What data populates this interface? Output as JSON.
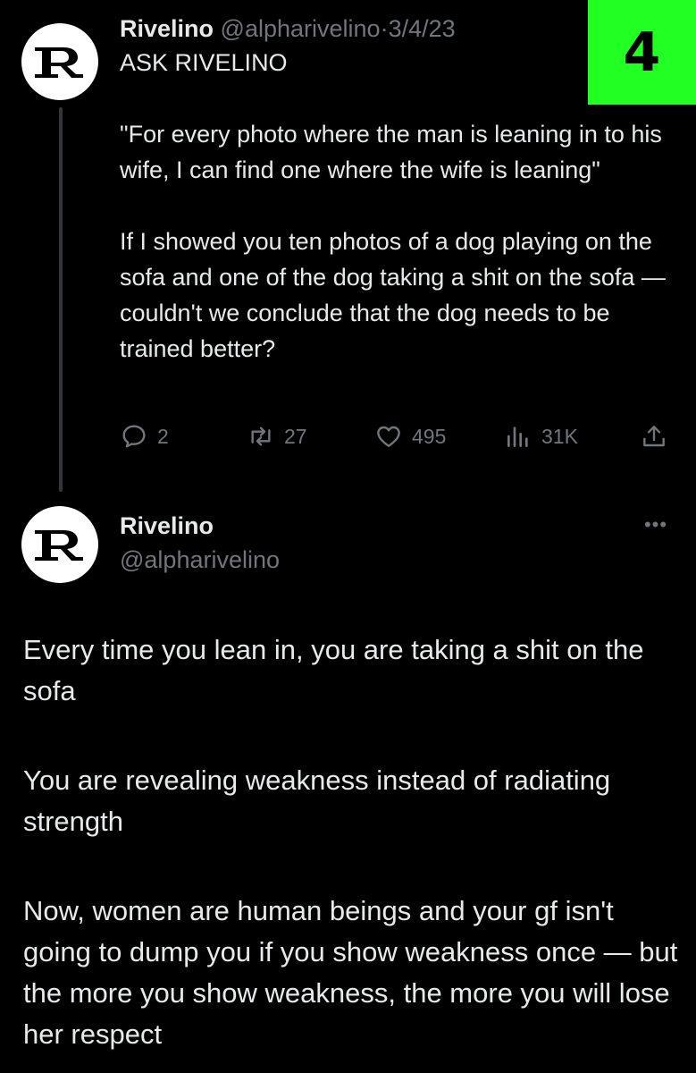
{
  "badge": {
    "number": "4",
    "color": "#22ff22"
  },
  "parent_tweet": {
    "avatar_letter": "R",
    "name": "Rivelino",
    "handle": "@alpharivelino",
    "separator": "·",
    "date": "3/4/23",
    "title": "ASK RIVELINO",
    "paragraphs": [
      "\"For every photo where the man is leaning in to his wife, I can find one where the wife is leaning\"",
      "If I showed you ten photos of a dog playing on the sofa and one of the dog taking a shit on the sofa — couldn't we conclude that the dog needs to be trained better?"
    ],
    "actions": {
      "replies": "2",
      "retweets": "27",
      "likes": "495",
      "views": "31K"
    }
  },
  "main_tweet": {
    "avatar_letter": "R",
    "name": "Rivelino",
    "handle": "@alpharivelino",
    "more_label": "•••",
    "paragraphs": [
      "Every time you lean in, you are taking a shit on the sofa",
      "You are revealing weakness instead of radiating strength",
      "Now, women are human beings and your gf isn't going to dump you if you show weakness once — but the more you show weakness, the more you will lose her respect"
    ]
  },
  "colors": {
    "background": "#000000",
    "text": "#e7e9ea",
    "muted": "#71767b",
    "thread_line": "#333639"
  }
}
